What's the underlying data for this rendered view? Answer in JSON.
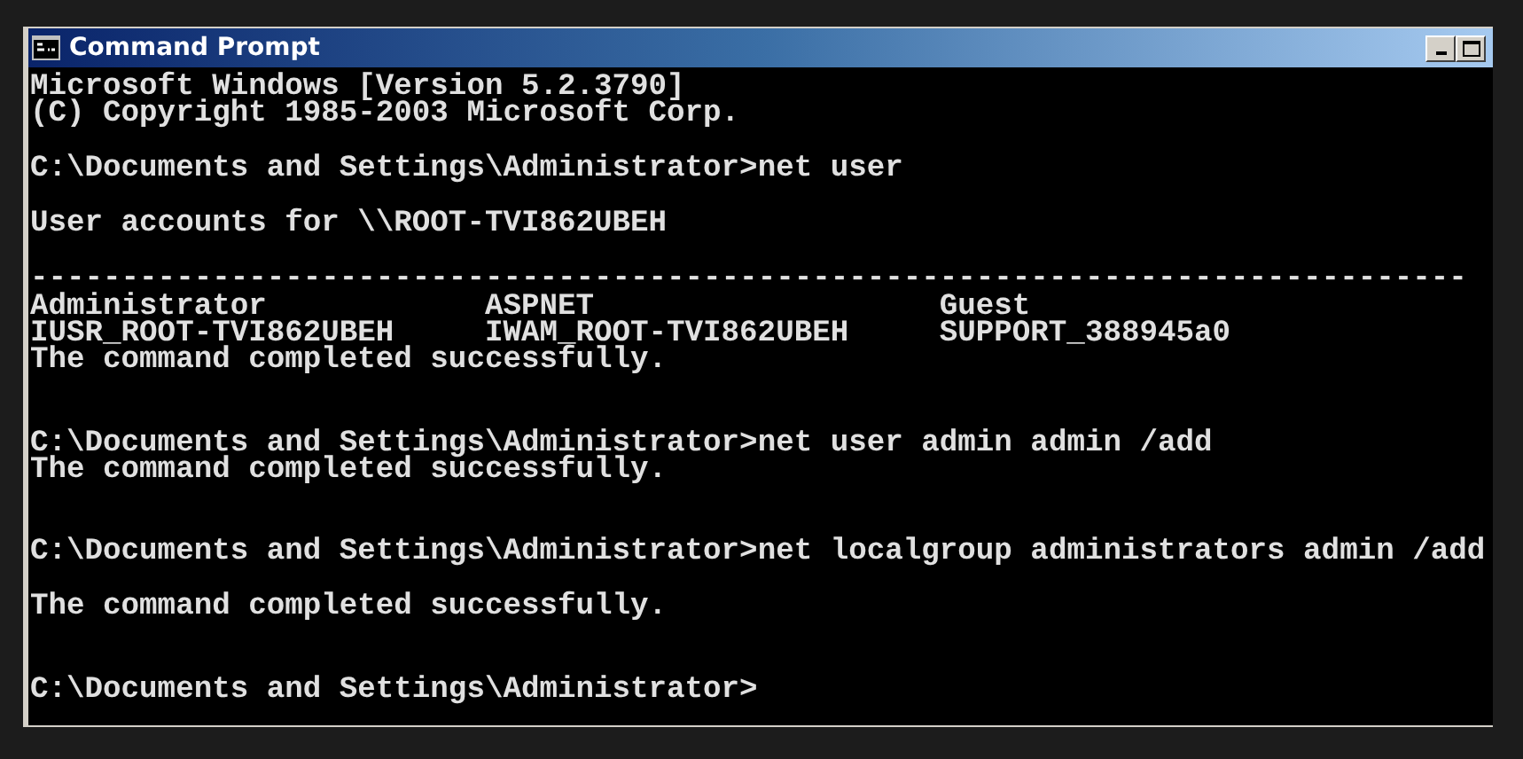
{
  "window": {
    "title": "Command Prompt",
    "buttons": [
      {
        "kind": "minimize"
      },
      {
        "kind": "maximize"
      }
    ]
  },
  "console": {
    "lines": [
      {
        "kind": "text",
        "text": "Microsoft Windows [Version 5.2.3790]"
      },
      {
        "kind": "text",
        "text": "(C) Copyright 1985-2003 Microsoft Corp."
      },
      {
        "kind": "blank"
      },
      {
        "kind": "text",
        "text": "C:\\Documents and Settings\\Administrator>net user"
      },
      {
        "kind": "blank"
      },
      {
        "kind": "text",
        "text": "User accounts for \\\\ROOT-TVI862UBEH"
      },
      {
        "kind": "blank"
      },
      {
        "kind": "rule",
        "text": "-------------------------------------------------------------------------------"
      },
      {
        "kind": "columns",
        "cells": [
          "Administrator",
          "ASPNET",
          "Guest"
        ]
      },
      {
        "kind": "columns",
        "cells": [
          "IUSR_ROOT-TVI862UBEH",
          "IWAM_ROOT-TVI862UBEH",
          "SUPPORT_388945a0"
        ]
      },
      {
        "kind": "text",
        "text": "The command completed successfully."
      },
      {
        "kind": "blank"
      },
      {
        "kind": "blank"
      },
      {
        "kind": "text",
        "text": "C:\\Documents and Settings\\Administrator>net user admin admin /add"
      },
      {
        "kind": "text",
        "text": "The command completed successfully."
      },
      {
        "kind": "blank"
      },
      {
        "kind": "blank"
      },
      {
        "kind": "text",
        "text": "C:\\Documents and Settings\\Administrator>net localgroup administrators admin /add"
      },
      {
        "kind": "blank"
      },
      {
        "kind": "text",
        "text": "The command completed successfully."
      },
      {
        "kind": "blank"
      },
      {
        "kind": "blank"
      },
      {
        "kind": "text",
        "text": "C:\\Documents and Settings\\Administrator>"
      }
    ]
  }
}
